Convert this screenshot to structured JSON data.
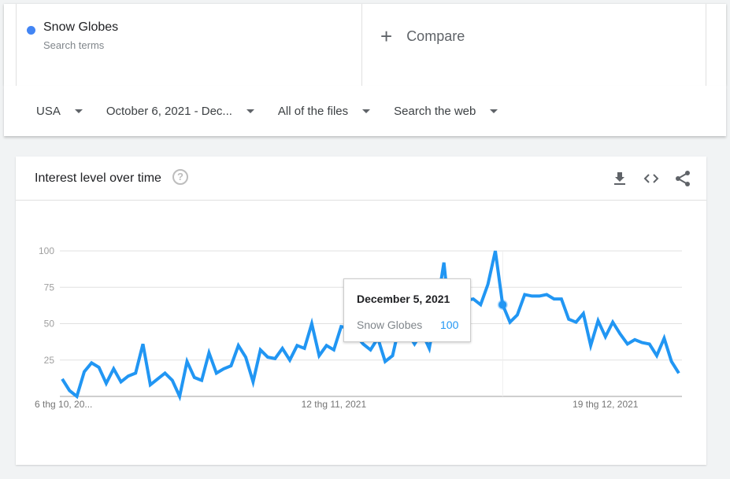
{
  "search_terms": [
    {
      "name": "Snow Globes",
      "subtitle": "Search terms",
      "color": "#4285f4"
    }
  ],
  "compare": {
    "icon": "plus-icon",
    "label": "Compare"
  },
  "filters": [
    {
      "label": "USA"
    },
    {
      "label": "October 6, 2021 - Dec..."
    },
    {
      "label": "All of the files"
    },
    {
      "label": "Search the web"
    }
  ],
  "chart_card": {
    "title": "Interest level over time",
    "help_icon": "?",
    "tools": [
      "download-icon",
      "embed-code-icon",
      "share-icon"
    ]
  },
  "tooltip": {
    "date": "December 5, 2021",
    "term": "Snow Globes",
    "value": "100"
  },
  "chart_data": {
    "type": "line",
    "title": "Interest level over time",
    "xlabel": "",
    "ylabel": "",
    "ylim": [
      0,
      100
    ],
    "yticks": [
      "25",
      "50",
      "75",
      "100"
    ],
    "ytick_values": [
      25,
      50,
      75,
      100
    ],
    "xtick_labels": [
      "6 thg 10, 20...",
      "12 thg 11, 2021",
      "19 thg 12, 2021"
    ],
    "xtick_indices": [
      0,
      37,
      74
    ],
    "grid": true,
    "line_color": "#2196f3",
    "highlight_index": 60,
    "series": [
      {
        "name": "Snow Globes",
        "start_date": "2021-10-06",
        "values": [
          12,
          4,
          0,
          17,
          23,
          20,
          9,
          19,
          10,
          14,
          16,
          36,
          8,
          12,
          16,
          11,
          0,
          24,
          13,
          11,
          30,
          16,
          19,
          21,
          35,
          27,
          10,
          32,
          27,
          26,
          33,
          25,
          35,
          33,
          50,
          28,
          35,
          32,
          48,
          47,
          42,
          36,
          32,
          40,
          24,
          28,
          50,
          44,
          36,
          44,
          33,
          60,
          92,
          44,
          47,
          66,
          67,
          63,
          77,
          100,
          63,
          51,
          56,
          70,
          69,
          69,
          70,
          67,
          67,
          53,
          51,
          57,
          35,
          52,
          41,
          51,
          43,
          36,
          39,
          37,
          36,
          28,
          40,
          24,
          16
        ]
      }
    ]
  }
}
